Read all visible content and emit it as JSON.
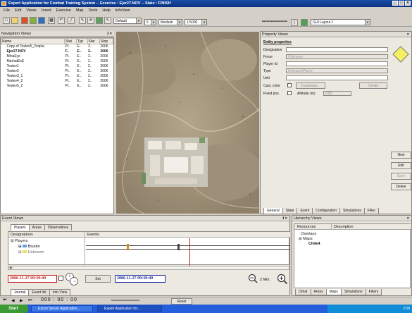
{
  "window": {
    "title": "Expert Application for Combat Training System -- Exercise : Ejer27.NOV -- State : FINISH"
  },
  "menu": [
    "File",
    "Edit",
    "Views",
    "Insert",
    "Exercise",
    "Map",
    "Tools",
    "Help",
    "InfoView"
  ],
  "toolbar": {
    "style_combo": "Default",
    "size_combo": "6",
    "quality_combo": "Medium",
    "scale_combo": "1:5000",
    "layout_combo": "GUI Layout 1"
  },
  "nav_views": {
    "title": "Navigation Views",
    "columns": [
      "Name",
      "Stat",
      "Typ",
      "Star",
      "Stop"
    ],
    "rows": [
      {
        "name": "Copy of Testev5_2copia",
        "stat": "Pl..",
        "typ": "E..",
        "star": "2..",
        "stop": "2006",
        "bold": false
      },
      {
        "name": "Ejer27.NOV",
        "stat": "F..",
        "typ": "E..",
        "star": "2..",
        "stop": "2006",
        "bold": true
      },
      {
        "name": "MinaEye",
        "stat": "Pl..",
        "typ": "E..",
        "star": "2..",
        "stop": "2006",
        "bold": false
      },
      {
        "name": "MarhatEsE",
        "stat": "Pl..",
        "typ": "E..",
        "star": "2..",
        "stop": "2006",
        "bold": false
      },
      {
        "name": "Testev1",
        "stat": "Pl..",
        "typ": "E..",
        "star": "2..",
        "stop": "2006",
        "bold": false
      },
      {
        "name": "Testev2",
        "stat": "Pl..",
        "typ": "E..",
        "star": "2..",
        "stop": "2006",
        "bold": false
      },
      {
        "name": "Testev3_1",
        "stat": "Pl..",
        "typ": "E..",
        "star": "2..",
        "stop": "2006",
        "bold": false
      },
      {
        "name": "Testev4_2",
        "stat": "Pl..",
        "typ": "E..",
        "star": "2..",
        "stop": "2006",
        "bold": false
      },
      {
        "name": "Testev5_2",
        "stat": "Pl..",
        "typ": "E..",
        "star": "2..",
        "stop": "2006",
        "bold": false
      }
    ]
  },
  "property": {
    "title": "Property Views",
    "section": "Entity properties",
    "designation_label": "Designation",
    "force_label": "Force",
    "force_value": "Unknown",
    "player_id_label": "Player Id",
    "type_label": "Type",
    "type_value": "UnknownPlayer",
    "unit_label": "Unit",
    "cust_color_label": "Cust. color",
    "customize_btn": "Customize...",
    "center_btn": "Center",
    "fixed_pos_label": "Fixed pos.",
    "altitude_label": "Altitude (m)",
    "altitude_value": "0.00",
    "side_buttons": [
      "New",
      "Edit",
      "Save",
      "Delete"
    ],
    "tabs": [
      "General",
      "State",
      "Event",
      "Configuration",
      "Simulations",
      "Filter"
    ]
  },
  "event_views": {
    "title": "Event Views",
    "tabs": [
      "Players",
      "Areas",
      "Observations"
    ],
    "col_designations": "Designations",
    "col_events": "Events",
    "tree": [
      "Players",
      "Bluefor",
      "Unknown"
    ],
    "start_time": "2006-11-27 09:39:40",
    "end_time": "2006-11-27 09:39:40",
    "set_btn": "Set",
    "zoom_label": "2 Min.",
    "bottom_tabs": [
      "Journal",
      "Event list",
      "Info View"
    ]
  },
  "hierarchy": {
    "title": "Hierarchy Views",
    "col_resources": "Resources",
    "col_description": "Description",
    "tree": [
      "Overlays",
      "Maps",
      "Chile4"
    ],
    "tabs": [
      "Orbat",
      "Areas",
      "Maps",
      "Simulations",
      "Filters"
    ]
  },
  "playback": {
    "time": "000 : 00 : 00",
    "reset_btn": "Reset"
  },
  "taskbar": {
    "start": "Start",
    "items": [
      "Excon Server Application...",
      "Expert Application for..."
    ],
    "clock": "2:58"
  }
}
